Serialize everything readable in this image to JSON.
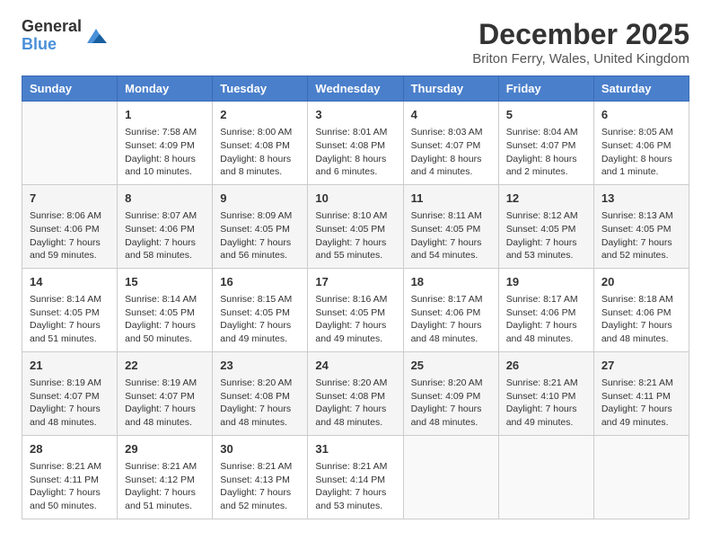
{
  "logo": {
    "line1": "General",
    "line2": "Blue"
  },
  "title": "December 2025",
  "subtitle": "Briton Ferry, Wales, United Kingdom",
  "weekdays": [
    "Sunday",
    "Monday",
    "Tuesday",
    "Wednesday",
    "Thursday",
    "Friday",
    "Saturday"
  ],
  "weeks": [
    [
      {
        "day": "",
        "info": ""
      },
      {
        "day": "1",
        "info": "Sunrise: 7:58 AM\nSunset: 4:09 PM\nDaylight: 8 hours\nand 10 minutes."
      },
      {
        "day": "2",
        "info": "Sunrise: 8:00 AM\nSunset: 4:08 PM\nDaylight: 8 hours\nand 8 minutes."
      },
      {
        "day": "3",
        "info": "Sunrise: 8:01 AM\nSunset: 4:08 PM\nDaylight: 8 hours\nand 6 minutes."
      },
      {
        "day": "4",
        "info": "Sunrise: 8:03 AM\nSunset: 4:07 PM\nDaylight: 8 hours\nand 4 minutes."
      },
      {
        "day": "5",
        "info": "Sunrise: 8:04 AM\nSunset: 4:07 PM\nDaylight: 8 hours\nand 2 minutes."
      },
      {
        "day": "6",
        "info": "Sunrise: 8:05 AM\nSunset: 4:06 PM\nDaylight: 8 hours\nand 1 minute."
      }
    ],
    [
      {
        "day": "7",
        "info": "Sunrise: 8:06 AM\nSunset: 4:06 PM\nDaylight: 7 hours\nand 59 minutes."
      },
      {
        "day": "8",
        "info": "Sunrise: 8:07 AM\nSunset: 4:06 PM\nDaylight: 7 hours\nand 58 minutes."
      },
      {
        "day": "9",
        "info": "Sunrise: 8:09 AM\nSunset: 4:05 PM\nDaylight: 7 hours\nand 56 minutes."
      },
      {
        "day": "10",
        "info": "Sunrise: 8:10 AM\nSunset: 4:05 PM\nDaylight: 7 hours\nand 55 minutes."
      },
      {
        "day": "11",
        "info": "Sunrise: 8:11 AM\nSunset: 4:05 PM\nDaylight: 7 hours\nand 54 minutes."
      },
      {
        "day": "12",
        "info": "Sunrise: 8:12 AM\nSunset: 4:05 PM\nDaylight: 7 hours\nand 53 minutes."
      },
      {
        "day": "13",
        "info": "Sunrise: 8:13 AM\nSunset: 4:05 PM\nDaylight: 7 hours\nand 52 minutes."
      }
    ],
    [
      {
        "day": "14",
        "info": "Sunrise: 8:14 AM\nSunset: 4:05 PM\nDaylight: 7 hours\nand 51 minutes."
      },
      {
        "day": "15",
        "info": "Sunrise: 8:14 AM\nSunset: 4:05 PM\nDaylight: 7 hours\nand 50 minutes."
      },
      {
        "day": "16",
        "info": "Sunrise: 8:15 AM\nSunset: 4:05 PM\nDaylight: 7 hours\nand 49 minutes."
      },
      {
        "day": "17",
        "info": "Sunrise: 8:16 AM\nSunset: 4:05 PM\nDaylight: 7 hours\nand 49 minutes."
      },
      {
        "day": "18",
        "info": "Sunrise: 8:17 AM\nSunset: 4:06 PM\nDaylight: 7 hours\nand 48 minutes."
      },
      {
        "day": "19",
        "info": "Sunrise: 8:17 AM\nSunset: 4:06 PM\nDaylight: 7 hours\nand 48 minutes."
      },
      {
        "day": "20",
        "info": "Sunrise: 8:18 AM\nSunset: 4:06 PM\nDaylight: 7 hours\nand 48 minutes."
      }
    ],
    [
      {
        "day": "21",
        "info": "Sunrise: 8:19 AM\nSunset: 4:07 PM\nDaylight: 7 hours\nand 48 minutes."
      },
      {
        "day": "22",
        "info": "Sunrise: 8:19 AM\nSunset: 4:07 PM\nDaylight: 7 hours\nand 48 minutes."
      },
      {
        "day": "23",
        "info": "Sunrise: 8:20 AM\nSunset: 4:08 PM\nDaylight: 7 hours\nand 48 minutes."
      },
      {
        "day": "24",
        "info": "Sunrise: 8:20 AM\nSunset: 4:08 PM\nDaylight: 7 hours\nand 48 minutes."
      },
      {
        "day": "25",
        "info": "Sunrise: 8:20 AM\nSunset: 4:09 PM\nDaylight: 7 hours\nand 48 minutes."
      },
      {
        "day": "26",
        "info": "Sunrise: 8:21 AM\nSunset: 4:10 PM\nDaylight: 7 hours\nand 49 minutes."
      },
      {
        "day": "27",
        "info": "Sunrise: 8:21 AM\nSunset: 4:11 PM\nDaylight: 7 hours\nand 49 minutes."
      }
    ],
    [
      {
        "day": "28",
        "info": "Sunrise: 8:21 AM\nSunset: 4:11 PM\nDaylight: 7 hours\nand 50 minutes."
      },
      {
        "day": "29",
        "info": "Sunrise: 8:21 AM\nSunset: 4:12 PM\nDaylight: 7 hours\nand 51 minutes."
      },
      {
        "day": "30",
        "info": "Sunrise: 8:21 AM\nSunset: 4:13 PM\nDaylight: 7 hours\nand 52 minutes."
      },
      {
        "day": "31",
        "info": "Sunrise: 8:21 AM\nSunset: 4:14 PM\nDaylight: 7 hours\nand 53 minutes."
      },
      {
        "day": "",
        "info": ""
      },
      {
        "day": "",
        "info": ""
      },
      {
        "day": "",
        "info": ""
      }
    ]
  ]
}
